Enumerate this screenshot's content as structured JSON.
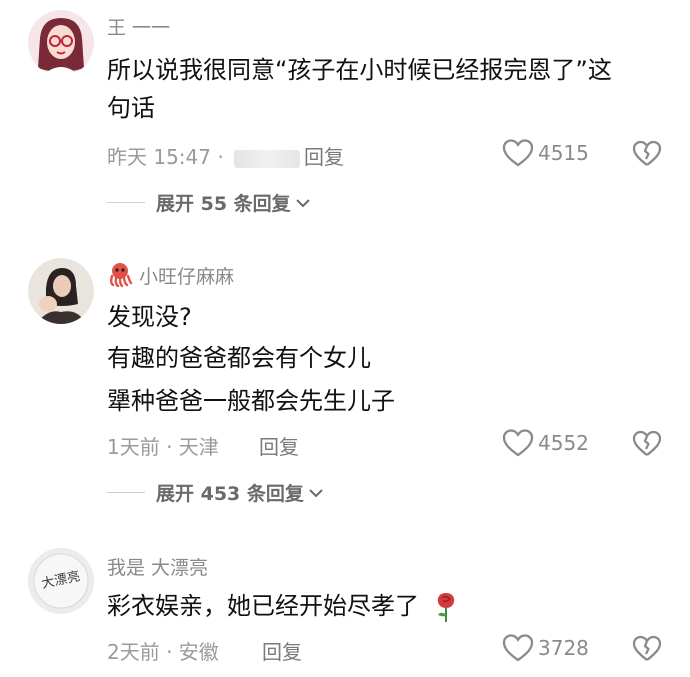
{
  "comments": [
    {
      "username": "王 一一",
      "lines": [
        "所以说我很同意“孩子在小时候已经报完恩了”这",
        "句话"
      ],
      "meta": "昨天 15:47 · ",
      "reply_label": "回复",
      "likes": "4515",
      "expand_label": "展开 55 条回复"
    },
    {
      "username": "小旺仔麻麻",
      "lines": [
        "发现没?",
        "有趣的爸爸都会有个女儿",
        "犟种爸爸一般都会先生儿子"
      ],
      "meta": "1天前 · 天津",
      "reply_label": "回复",
      "likes": "4552",
      "expand_label": "展开 453 条回复"
    },
    {
      "username": "我是 大漂亮",
      "lines": [
        "彩衣娱亲，她已经开始尽孝了"
      ],
      "meta": "2天前 · 安徽",
      "reply_label": "回复",
      "likes": "3728",
      "avatar_text": "大漂亮"
    }
  ],
  "colors": {
    "text": "#111111",
    "muted": "#8a8a8a",
    "accent_rose": "#d23b3b"
  }
}
